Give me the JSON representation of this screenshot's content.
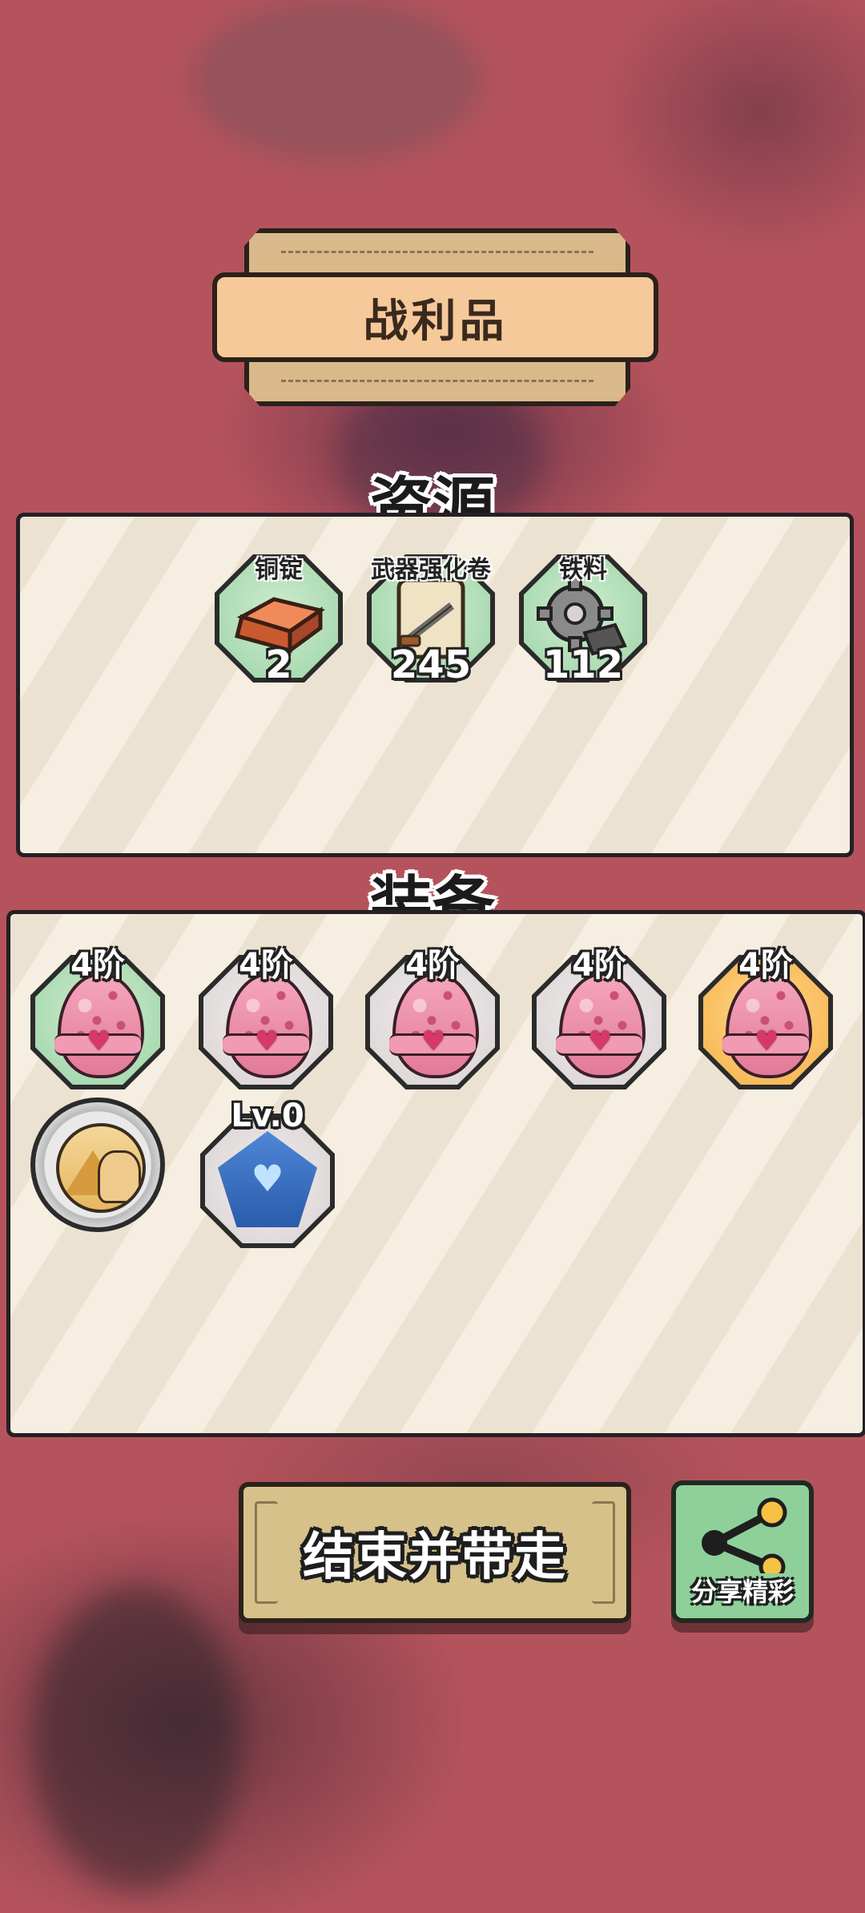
{
  "title": "战利品",
  "resources": {
    "header": "资源",
    "items": [
      {
        "name": "铜锭",
        "count": "2",
        "icon": "copper-ingot-icon"
      },
      {
        "name": "武器强化卷",
        "count": "245",
        "icon": "weapon-scroll-icon"
      },
      {
        "name": "铁料",
        "count": "112",
        "icon": "iron-gear-icon"
      }
    ]
  },
  "equipment": {
    "header": "装备",
    "eggs": [
      {
        "tier": "4阶",
        "rarity": "green",
        "icon": "pink-egg-icon"
      },
      {
        "tier": "4阶",
        "rarity": "grey",
        "icon": "pink-egg-icon"
      },
      {
        "tier": "4阶",
        "rarity": "grey",
        "icon": "pink-egg-icon"
      },
      {
        "tier": "4阶",
        "rarity": "grey",
        "icon": "pink-egg-icon"
      },
      {
        "tier": "4阶",
        "rarity": "orange",
        "icon": "pink-egg-icon"
      }
    ],
    "medal": {
      "icon": "sphinx-medal-icon"
    },
    "gem": {
      "level": "Lv.0",
      "icon": "blue-pentagon-gem-icon"
    }
  },
  "buttons": {
    "end": "结束并带走",
    "share": "分享精彩"
  },
  "colors": {
    "background": "#b5535c",
    "panel": "#f6eee0",
    "green_frame": "#9ed4a8",
    "orange_frame": "#f6b04a"
  }
}
